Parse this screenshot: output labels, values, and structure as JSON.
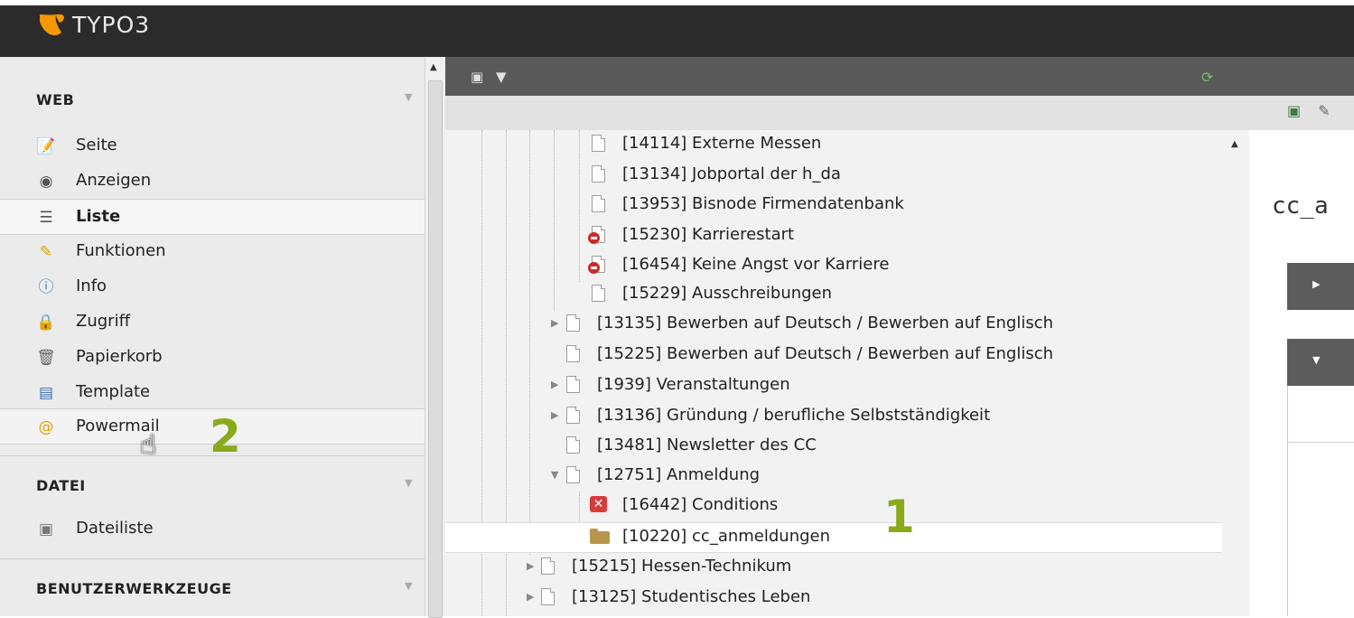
{
  "app": {
    "logo_text": "TYPO3"
  },
  "modules": {
    "web": {
      "title": "WEB",
      "items": [
        {
          "label": "Seite",
          "icon": "page-edit-icon"
        },
        {
          "label": "Anzeigen",
          "icon": "eye-icon"
        },
        {
          "label": "Liste",
          "icon": "list-icon",
          "active": true
        },
        {
          "label": "Funktionen",
          "icon": "wand-icon"
        },
        {
          "label": "Info",
          "icon": "info-icon"
        },
        {
          "label": "Zugriff",
          "icon": "lock-icon"
        },
        {
          "label": "Papierkorb",
          "icon": "trash-icon"
        },
        {
          "label": "Template",
          "icon": "template-icon"
        },
        {
          "label": "Powermail",
          "icon": "powermail-icon"
        }
      ]
    },
    "datei": {
      "title": "DATEI",
      "items": [
        {
          "label": "Dateiliste",
          "icon": "folder-list-icon"
        }
      ]
    },
    "tools": {
      "title": "BENUTZERWERKZEUGE"
    }
  },
  "tree": {
    "nodes": [
      {
        "label": "[14114] Externe Messen",
        "icon": "page"
      },
      {
        "label": "[13134] Jobportal der h_da",
        "icon": "page"
      },
      {
        "label": "[13953] Bisnode Firmendatenbank",
        "icon": "page"
      },
      {
        "label": "[15230] Karrierestart",
        "icon": "page-hidden"
      },
      {
        "label": "[16454] Keine Angst vor Karriere",
        "icon": "page-hidden"
      },
      {
        "label": "[15229] Ausschreibungen",
        "icon": "page"
      },
      {
        "label": "[13135] Bewerben auf Deutsch / Bewerben auf Englisch",
        "icon": "page"
      },
      {
        "label": "[15225] Bewerben auf Deutsch / Bewerben auf Englisch",
        "icon": "page"
      },
      {
        "label": "[1939] Veranstaltungen",
        "icon": "page"
      },
      {
        "label": "[13136] Gründung / berufliche Selbstständigkeit",
        "icon": "page"
      },
      {
        "label": "[13481] Newsletter des CC",
        "icon": "page"
      },
      {
        "label": "[12751] Anmeldung",
        "icon": "page"
      },
      {
        "label": "[16442] Conditions",
        "icon": "error"
      },
      {
        "label": "[10220] cc_anmeldungen",
        "icon": "folder"
      },
      {
        "label": "[15215] Hessen-Technikum",
        "icon": "page"
      },
      {
        "label": "[13125] Studentisches Leben",
        "icon": "page"
      }
    ]
  },
  "content": {
    "title": "cc_a"
  },
  "annotations": {
    "marker_1": "1",
    "marker_2": "2"
  }
}
